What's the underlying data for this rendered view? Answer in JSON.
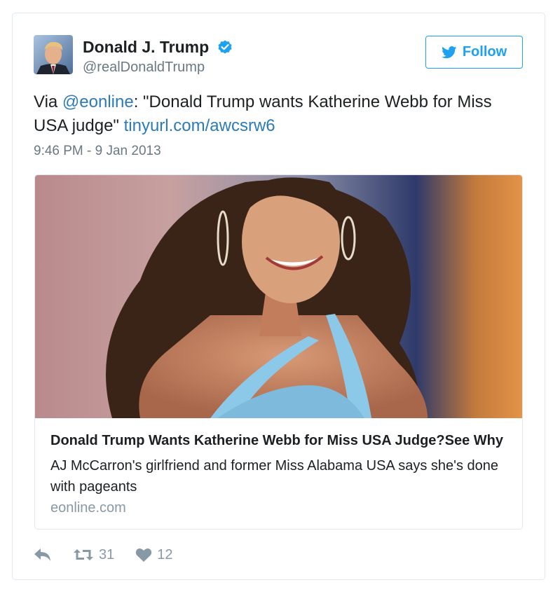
{
  "author": {
    "display_name": "Donald J. Trump",
    "screen_name": "@realDonaldTrump",
    "verified": true
  },
  "follow_button": {
    "label": "Follow"
  },
  "tweet": {
    "text_prefix": "Via ",
    "mention": "@eonline",
    "text_main": ": \"Donald Trump wants Katherine Webb for Miss USA judge\" ",
    "link": "tinyurl.com/awcsrw6",
    "timestamp": "9:46 PM - 9 Jan 2013"
  },
  "card": {
    "title": "Donald Trump Wants Katherine Webb for Miss USA Judge?See Why",
    "description": "AJ McCarron's girlfriend and former Miss Alabama USA says she's done with pageants",
    "domain": "eonline.com"
  },
  "actions": {
    "retweet_count": "31",
    "like_count": "12"
  },
  "icons": {
    "reply": "reply-icon",
    "retweet": "retweet-icon",
    "like": "heart-icon",
    "verified": "verified-badge-icon",
    "follow": "twitter-bird-icon"
  },
  "colors": {
    "link": "#2b7bb9",
    "follow": "#1da1f2",
    "muted": "#697882",
    "action": "#8899a6"
  }
}
